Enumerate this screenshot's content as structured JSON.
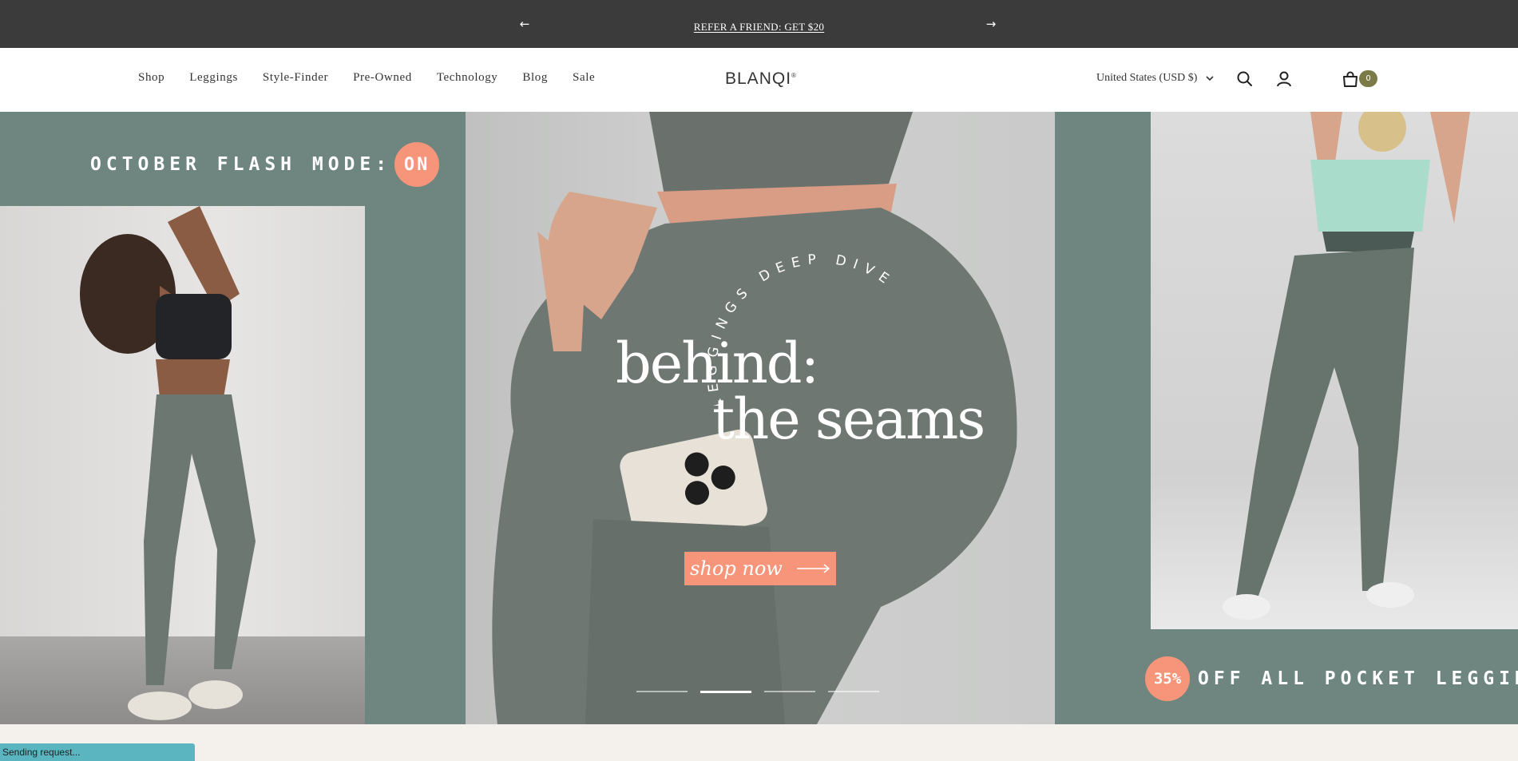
{
  "announcement": {
    "message": "REFER A FRIEND: GET $20",
    "prev_icon": "arrow-left-icon",
    "next_icon": "arrow-right-icon"
  },
  "header": {
    "nav": [
      "Shop",
      "Leggings",
      "Style-Finder",
      "Pre-Owned",
      "Technology",
      "Blog",
      "Sale"
    ],
    "logo": "BLANQI",
    "logo_mark": "®",
    "country": "United States (USD $)",
    "cart_count": "0",
    "icons": [
      "search-icon",
      "account-icon",
      "cart-icon"
    ]
  },
  "hero": {
    "flash_label": "OCTOBER FLASH MODE:",
    "flash_state": "ON",
    "arc_text": "LEGGINGS DEEP DIVE",
    "headline_line1": "behind:",
    "headline_line2": "the seams",
    "cta_label": "shop now",
    "promo_percent": "35%",
    "promo_text": "OFF ALL POCKET LEGGINGS",
    "slides_total": 4,
    "slide_active": 2
  },
  "status_bar": {
    "text": "Sending request..."
  },
  "colors": {
    "announce_bg": "#3b3b3b",
    "hero_bg": "#6f8680",
    "accent": "#f6957a",
    "badge": "#7c7a47"
  }
}
